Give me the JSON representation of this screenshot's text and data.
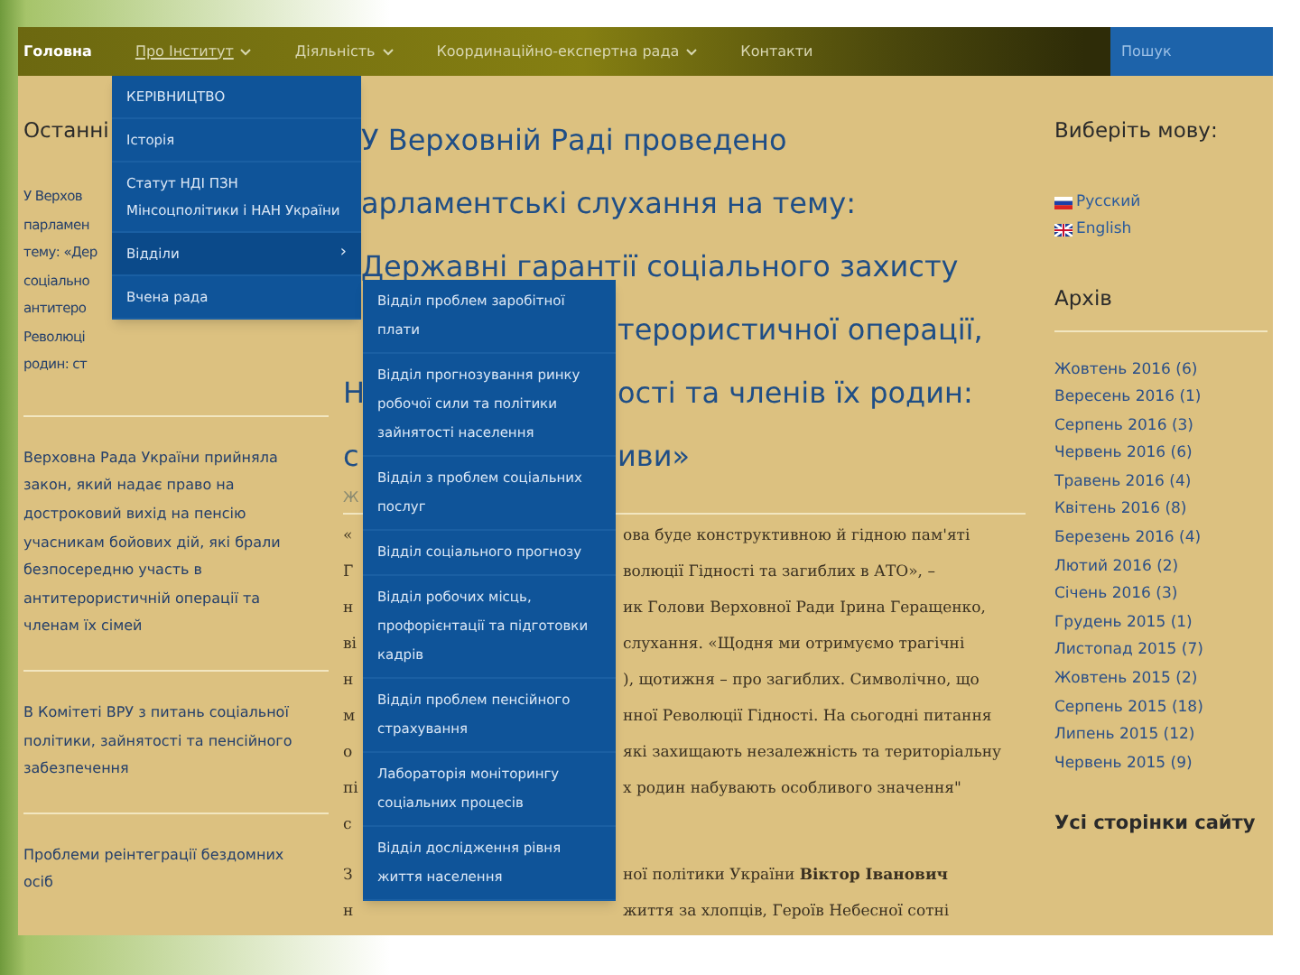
{
  "nav": {
    "items": [
      {
        "label": "Головна",
        "selected": true,
        "has_dropdown": false,
        "expanded": false
      },
      {
        "label": "Про Інститут",
        "selected": false,
        "has_dropdown": true,
        "expanded": true,
        "children": [
          {
            "label": "КЕРІВНИЦТВО",
            "expanded": false
          },
          {
            "label": "Історія",
            "expanded": false
          },
          {
            "label": "Статут НДІ ПЗН Мінсоцполітики і НАН України",
            "expanded": false
          },
          {
            "label": "Відділи",
            "expanded": true,
            "arrow": "›",
            "children": [
              {
                "label": "Відділ проблем заробітної плати"
              },
              {
                "label": "Відділ прогнозування ринку робочої сили та політики зайнятості населення"
              },
              {
                "label": "Відділ з проблем соціальних послуг"
              },
              {
                "label": "Відділ соціального прогнозу"
              },
              {
                "label": "Відділ робочих місць, профорієнтації та підготовки кадрів"
              },
              {
                "label": "Відділ проблем пенсійного страхування"
              },
              {
                "label": "Лабораторія моніторингу соціальних процесів"
              },
              {
                "label": "Відділ дослідження рівня життя населення"
              }
            ]
          },
          {
            "label": "Вчена рада",
            "expanded": false
          }
        ]
      },
      {
        "label": "Діяльність",
        "selected": false,
        "has_dropdown": true,
        "expanded": false
      },
      {
        "label": "Координаційно-експертна рада",
        "selected": false,
        "has_dropdown": true,
        "expanded": false
      },
      {
        "label": "Контакти",
        "selected": false,
        "has_dropdown": false,
        "expanded": false
      }
    ],
    "search": {
      "placeholder": "Пошук"
    }
  },
  "sidebar": {
    "heading": "Останні",
    "posts": [
      {
        "lines": [
          "У Верхов",
          "парламен",
          "тему: «Дер",
          "соціально",
          "антитеро",
          "Революці",
          "родин: ст"
        ]
      },
      {
        "lines": [
          "Верховна Рада України прийняла закон, який надає право на достроковий вихід на пенсію учасникам бойових дій, які брали безпосередню участь в антитерористичній операції та членам їх сімей"
        ]
      },
      {
        "lines": [
          "В Комітеті ВРУ з питань соціальної політики, зайнятості та пенсійного забезпечення"
        ]
      },
      {
        "lines": [
          "Проблеми реінтеграції бездомних осіб"
        ]
      }
    ]
  },
  "article": {
    "title_lines": [
      {
        "right": "У Верховній Раді проведено"
      },
      {
        "right": "арламентські слухання на тему:"
      },
      {
        "right": "Державні гарантії соціального захисту"
      },
      {
        "right": "терористичної операції,"
      },
      {
        "left": "Н",
        "right": "ості та членів їх родин:"
      },
      {
        "left": "с",
        "right": "иви»"
      }
    ],
    "meta": "Ж",
    "paragraphs": [
      [
        {
          "left": "«",
          "right": "ова буде конструктивною й гідною пам'яті"
        },
        {
          "left": "Г",
          "right": "волюції Гідності та загиблих в АТО», –"
        },
        {
          "left": "н",
          "right": "ик Голови Верховної Ради Ірина Геращенко,"
        },
        {
          "left": "ві",
          "right": "слухання. «Щодня ми отримуємо трагічні"
        },
        {
          "left": "н",
          "right": "), щотижня – про загиблих. Символічно, що"
        },
        {
          "left": "м",
          "right": "нної Революції Гідності. На сьогодні питання"
        },
        {
          "left": "о",
          "right": "які захищають незалежність та територіальну"
        },
        {
          "left": "пі",
          "right": "х родин набувають особливого значення\""
        },
        {
          "left": "с"
        }
      ],
      [
        {
          "left": "З",
          "right": "ної політики України **Віктор Іванович**"
        },
        {
          "left": "н",
          "right": "життя за хлопців, Героїв Небесної сотні"
        }
      ]
    ]
  },
  "right_sidebar": {
    "language_heading": "Виберіть мову:",
    "languages": [
      {
        "label": "Русский"
      },
      {
        "label": "English"
      }
    ],
    "archive_heading": "Архів",
    "archive": [
      "Жовтень 2016 (6)",
      "Вересень 2016 (1)",
      "Серпень 2016 (3)",
      "Червень 2016 (6)",
      "Травень 2016 (4)",
      "Квітень 2016 (8)",
      "Березень 2016 (4)",
      "Лютий 2016 (2)",
      "Січень 2016 (3)",
      "Грудень 2015 (1)",
      "Листопад 2015 (7)",
      "Жовтень 2015 (2)",
      "Серпень 2015 (18)",
      "Липень 2015 (12)",
      "Червень 2015 (9)"
    ],
    "pages_heading": "Усі сторінки сайту"
  }
}
